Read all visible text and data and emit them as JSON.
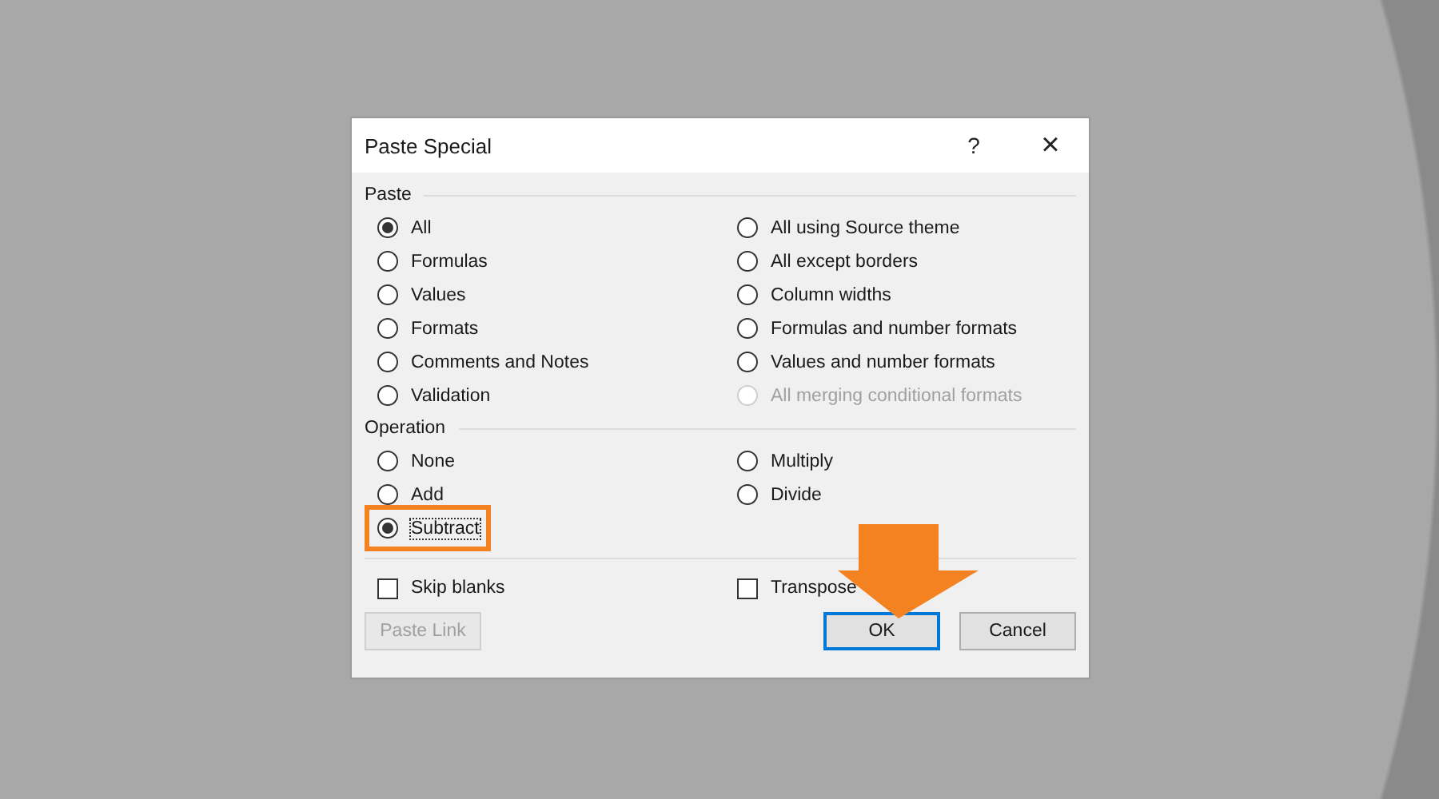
{
  "window": {
    "title": "Paste Special",
    "help": "?",
    "close": "×"
  },
  "paste": {
    "label": "Paste",
    "options": [
      {
        "label": "All",
        "selected": true,
        "disabled": false
      },
      {
        "label": "All using Source theme",
        "selected": false,
        "disabled": false
      },
      {
        "label": "Formulas",
        "selected": false,
        "disabled": false
      },
      {
        "label": "All except borders",
        "selected": false,
        "disabled": false
      },
      {
        "label": "Values",
        "selected": false,
        "disabled": false
      },
      {
        "label": "Column widths",
        "selected": false,
        "disabled": false
      },
      {
        "label": "Formats",
        "selected": false,
        "disabled": false
      },
      {
        "label": "Formulas and number formats",
        "selected": false,
        "disabled": false
      },
      {
        "label": "Comments and Notes",
        "selected": false,
        "disabled": false
      },
      {
        "label": "Values and number formats",
        "selected": false,
        "disabled": false
      },
      {
        "label": "Validation",
        "selected": false,
        "disabled": false
      },
      {
        "label": "All merging conditional formats",
        "selected": false,
        "disabled": true
      }
    ]
  },
  "operation": {
    "label": "Operation",
    "options": [
      {
        "label": "None",
        "selected": false,
        "highlighted": false
      },
      {
        "label": "Multiply",
        "selected": false,
        "highlighted": false
      },
      {
        "label": "Add",
        "selected": false,
        "highlighted": false
      },
      {
        "label": "Divide",
        "selected": false,
        "highlighted": false
      },
      {
        "label": "Subtract",
        "selected": true,
        "highlighted": true
      }
    ]
  },
  "checkboxes": [
    {
      "label": "Skip blanks",
      "checked": false
    },
    {
      "label": "Transpose",
      "checked": false
    }
  ],
  "buttons": [
    {
      "label": "Paste Link",
      "disabled": true,
      "default": false
    },
    {
      "label": "OK",
      "disabled": false,
      "default": true
    },
    {
      "label": "Cancel",
      "disabled": false,
      "default": false
    }
  ]
}
